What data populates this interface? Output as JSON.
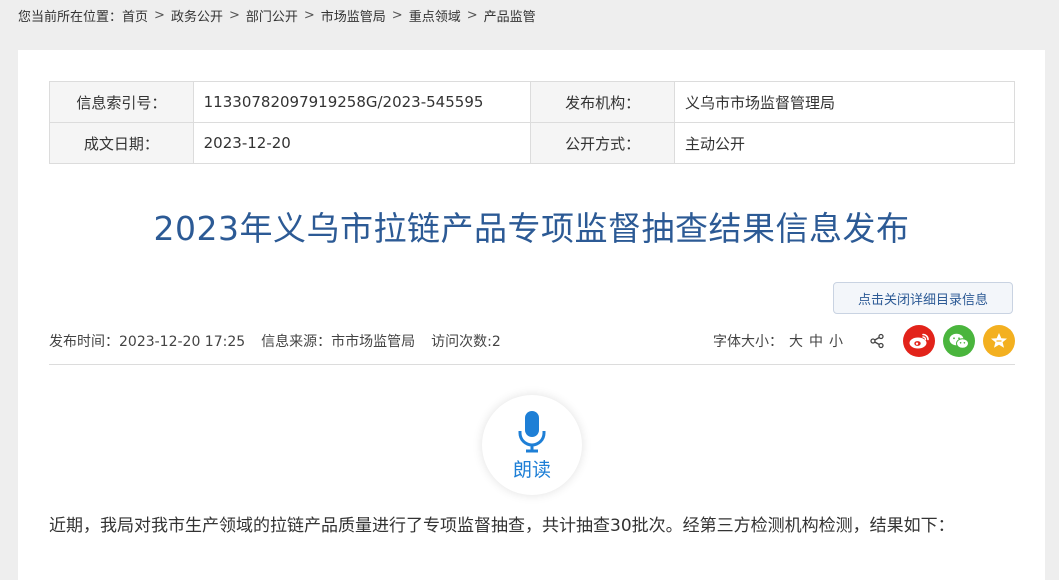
{
  "breadcrumb": {
    "prefix": "您当前所在位置：",
    "items": [
      "首页",
      "政务公开",
      "部门公开",
      "市场监管局",
      "重点领域",
      "产品监管"
    ],
    "separator": ">"
  },
  "meta": {
    "index_label": "信息索引号：",
    "index_value": "11330782097919258G/2023-545595",
    "publisher_label": "发布机构：",
    "publisher_value": "义乌市市场监督管理局",
    "date_label": "成文日期：",
    "date_value": "2023-12-20",
    "method_label": "公开方式：",
    "method_value": "主动公开"
  },
  "article": {
    "title": "2023年义乌市拉链产品专项监督抽查结果信息发布",
    "toggle_button": "点击关闭详细目录信息",
    "publish_time": "发布时间：2023-12-20 17:25",
    "source": "信息来源：市市场监管局",
    "visits": "访问次数:2",
    "font_size_label": "字体大小：",
    "font_sizes": [
      "大",
      "中",
      "小"
    ],
    "read_label": "朗读",
    "body": "近期，我局对我市生产领域的拉链产品质量进行了专项监督抽查，共计抽查30批次。经第三方检测机构检测，结果如下："
  },
  "colors": {
    "title": "#2c5a95",
    "weibo": "#e2231a",
    "wechat": "#4ab53d",
    "favorite": "#f3b020",
    "read_accent": "#1e7fd6"
  },
  "icons": [
    "share-icon",
    "weibo-icon",
    "wechat-icon",
    "favorite-star-icon",
    "microphone-icon"
  ]
}
